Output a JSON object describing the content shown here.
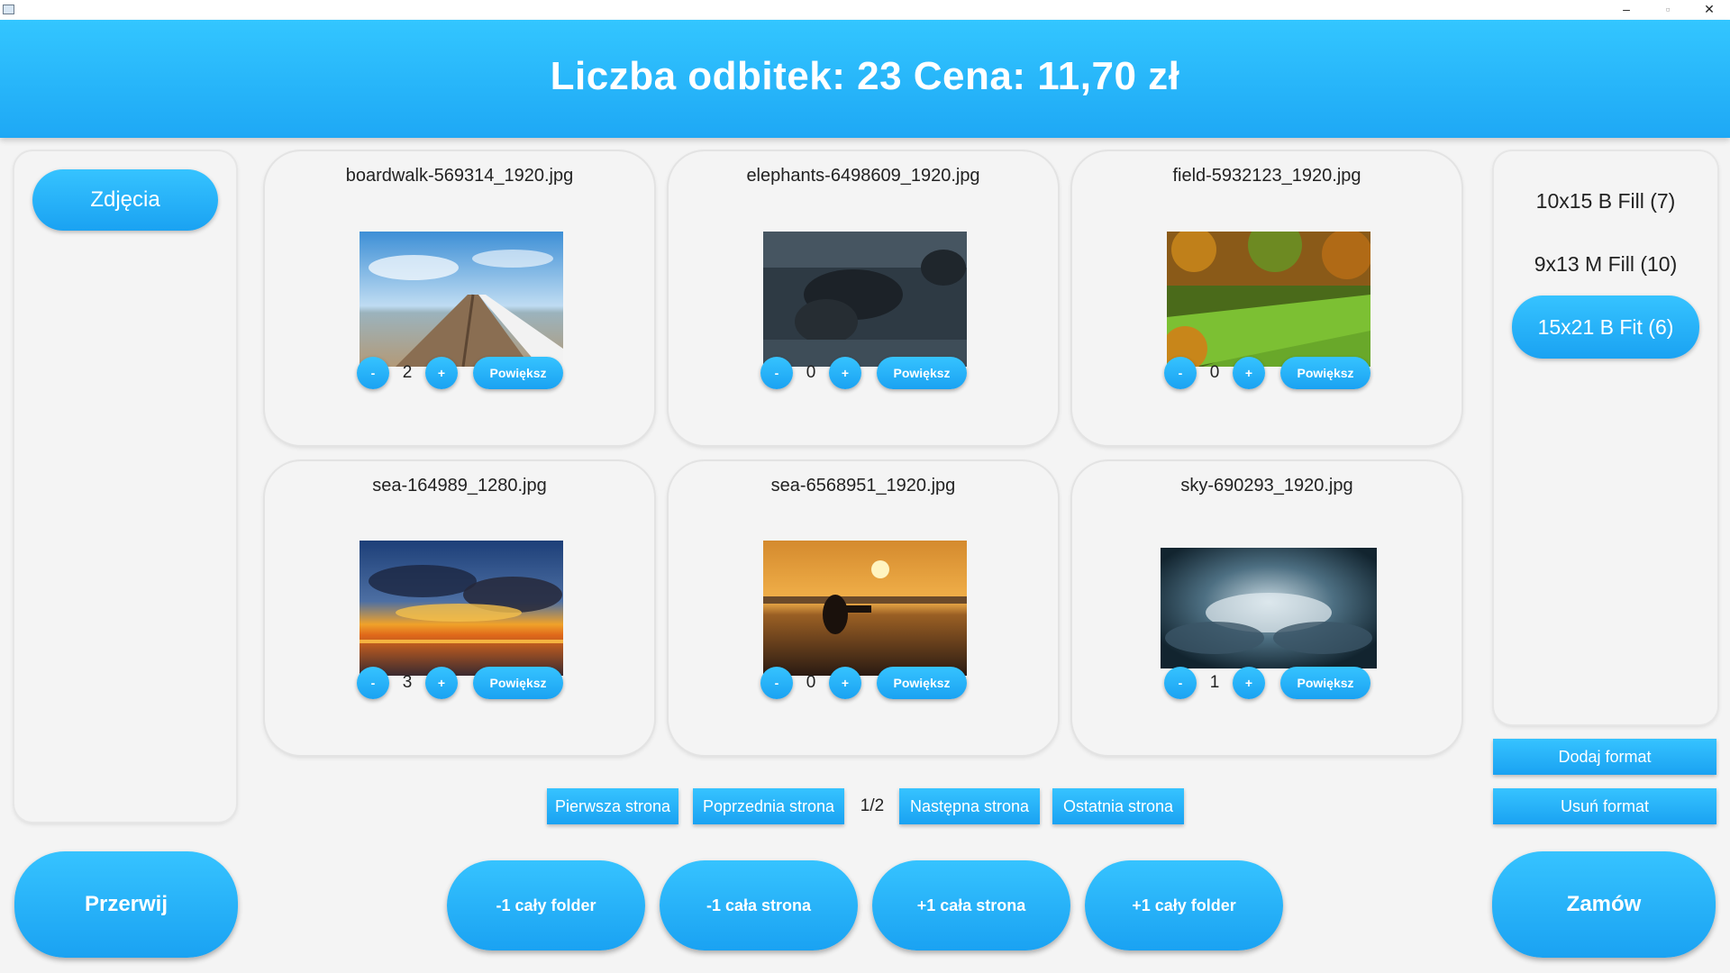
{
  "window": {
    "minimize": "–",
    "maximize": "▫",
    "close": "✕"
  },
  "header": {
    "title": "Liczba odbitek: 23 Cena: 11,70 zł"
  },
  "sidebar": {
    "folders": [
      "Zdjęcia"
    ]
  },
  "cards": [
    {
      "filename": "boardwalk-569314_1920.jpg",
      "quantity": "2",
      "minus": "-",
      "plus": "+",
      "zoom": "Powiększ",
      "thumb": "boardwalk-photo"
    },
    {
      "filename": "elephants-6498609_1920.jpg",
      "quantity": "0",
      "minus": "-",
      "plus": "+",
      "zoom": "Powiększ",
      "thumb": "elephants-photo"
    },
    {
      "filename": "field-5932123_1920.jpg",
      "quantity": "0",
      "minus": "-",
      "plus": "+",
      "zoom": "Powiększ",
      "thumb": "field-photo"
    },
    {
      "filename": "sea-164989_1280.jpg",
      "quantity": "3",
      "minus": "-",
      "plus": "+",
      "zoom": "Powiększ",
      "thumb": "sunset-photo"
    },
    {
      "filename": "sea-6568951_1920.jpg",
      "quantity": "0",
      "minus": "-",
      "plus": "+",
      "zoom": "Powiększ",
      "thumb": "surfer-photo"
    },
    {
      "filename": "sky-690293_1920.jpg",
      "quantity": "1",
      "minus": "-",
      "plus": "+",
      "zoom": "Powiększ",
      "thumb": "sky-photo"
    }
  ],
  "pagination": {
    "first": "Pierwsza strona",
    "prev": "Poprzednia strona",
    "page": "1/2",
    "next": "Następna strona",
    "last": "Ostatnia strona"
  },
  "formats": {
    "items": [
      "10x15 B Fill (7)",
      "9x13 M Fill (10)",
      "15x21 B Fit (6)"
    ],
    "selected_index": 2,
    "add": "Dodaj format",
    "remove": "Usuń format"
  },
  "actions": {
    "abort": "Przerwij",
    "minus_folder": "-1 cały folder",
    "minus_page": "-1 cała strona",
    "plus_page": "+1 cała strona",
    "plus_folder": "+1 cały folder",
    "order": "Zamów"
  },
  "colors": {
    "accent": "#1ea8f5",
    "accent_light": "#36c3ff",
    "background": "#f4f4f4"
  }
}
